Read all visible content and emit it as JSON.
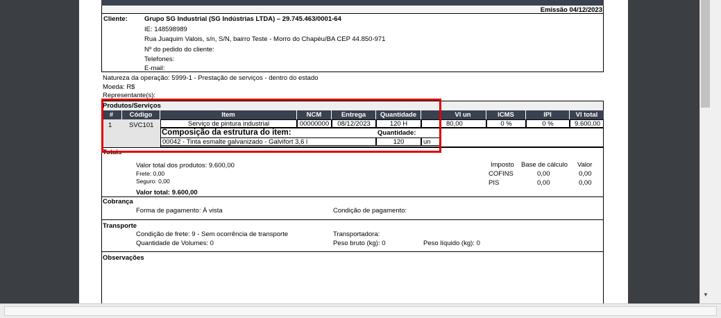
{
  "header": {
    "emissao": "Emissão 04/12/2023"
  },
  "cliente": {
    "label": "Cliente:",
    "name": "Grupo SG Industrial  (SG Indústrias LTDA) – 29.745.463/0001-64",
    "ie": "IE: 148598989",
    "address": "Rua Juaquim Valois, s/n, S/N, bairro Teste - Morro do Chapéu/BA CEP 44.850-971",
    "pedido": "Nº do pedido do cliente:",
    "telefones": "Telefones:",
    "email": "E-mail:"
  },
  "operacao": {
    "natureza": "Natureza da operação: 5999-1 - Prestação de serviços - dentro do estado",
    "moeda": "Moeda: R$",
    "representante": "Representante(s):"
  },
  "produtos": {
    "section": "Produtos/Serviços",
    "headers": [
      "#",
      "Código",
      "Item",
      "NCM",
      "Entrega",
      "Quantidade",
      "",
      "Vl un",
      "ICMS",
      "IPI",
      "Vl total"
    ],
    "row": {
      "num": "1",
      "codigo": "SVC101",
      "item": "Serviço de pintura industrial",
      "ncm": "00000000",
      "entrega": "08/12/2023",
      "quantidade": "120  H",
      "vl_un": "80,00",
      "icms": "0 %",
      "ipi": "0 %",
      "vl_total": "9.600,00"
    },
    "composicao": {
      "title": "Composição da estrutura do item:",
      "qty_label": "Quantidade:",
      "item": "00042 - Tinta esmalte galvanizado - Galvifort 3,6 l",
      "qty": "120",
      "unit": "un"
    }
  },
  "totais": {
    "section": "Totais",
    "valor_produtos": "Valor total dos produtos: 9.600,00",
    "frete": "Frete: 0,00",
    "seguro": "Seguro: 0,00",
    "valor_total": "Valor total: 9.600,00",
    "impostos_headers": [
      "Imposto",
      "Base de cálculo",
      "Valor"
    ],
    "impostos": [
      {
        "nome": "COFINS",
        "base": "0,00",
        "valor": "0,00"
      },
      {
        "nome": "PIS",
        "base": "0,00",
        "valor": "0,00"
      }
    ]
  },
  "cobranca": {
    "section": "Cobrança",
    "forma": "Forma de pagamento: À vista",
    "condicao": "Condição de pagamento:"
  },
  "transporte": {
    "section": "Transporte",
    "frete": "Condição de frete: 9 - Sem ocorrência de transporte",
    "transportadora": "Transportadora:",
    "volumes": "Quantidade de Volumes: 0",
    "peso_bruto": "Peso bruto (kg): 0",
    "peso_liquido": "Peso líquido (kg): 0"
  },
  "observacoes": {
    "section": "Observações"
  },
  "colors": {
    "header_bg": "#3a4150",
    "highlight": "#e00000"
  },
  "icons": {
    "scroll_down": "triangle-down-icon"
  }
}
